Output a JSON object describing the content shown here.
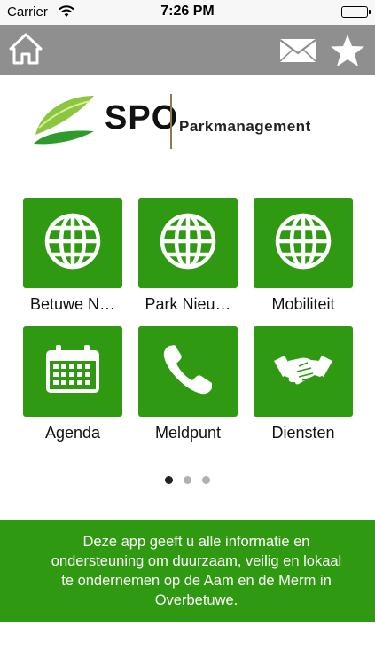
{
  "status_bar": {
    "carrier": "Carrier",
    "time": "7:26 PM",
    "wifi_icon": "wifi-icon",
    "battery_icon": "battery-icon"
  },
  "nav": {
    "home_icon": "home-icon",
    "mail_icon": "mail-icon",
    "favorite_icon": "star-icon",
    "background": "#8f8f8f"
  },
  "logo": {
    "brand": "SPO",
    "tagline": "Parkmanagement"
  },
  "tiles": [
    {
      "label": "Betuwe N…",
      "icon": "globe-icon"
    },
    {
      "label": "Park Nieu…",
      "icon": "globe-icon"
    },
    {
      "label": "Mobiliteit",
      "icon": "globe-icon"
    },
    {
      "label": "Agenda",
      "icon": "calendar-icon"
    },
    {
      "label": "Meldpunt",
      "icon": "phone-icon"
    },
    {
      "label": "Diensten",
      "icon": "handshake-icon"
    }
  ],
  "pager": {
    "pages": 3,
    "current": 1
  },
  "banner": {
    "text": "Deze app geeft u alle informatie en ondersteuning om duurzaam, veilig en lokaal te ondernemen op de Aam en de Merm in Overbetuwe."
  },
  "colors": {
    "accent_green": "#2f9a11",
    "navbar_gray": "#8f8f8f",
    "statusbar": "#f7f7f7"
  }
}
